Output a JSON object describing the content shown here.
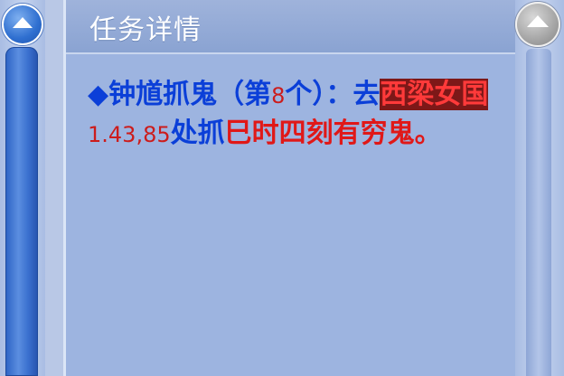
{
  "panel": {
    "title": "任务详情"
  },
  "task": {
    "bullet": "◆",
    "prefix": "钟馗抓鬼（第",
    "count": "8",
    "mid": "个）：去",
    "location_part1": "西",
    "location_part2": "梁女国",
    "coords": "1.43,85",
    "action": "处抓",
    "target_part1": "巳时四刻",
    "target_part2": "有穷鬼",
    "end": "。"
  },
  "colors": {
    "task_blue": "#0b3fd8",
    "highlight_red": "#e01818",
    "panel_bg": "#9db4e0",
    "scroll_blue": "#2f6fd0"
  },
  "icons": {
    "left_scroll_up": "triangle-up-icon",
    "right_scroll_up": "triangle-up-icon"
  }
}
